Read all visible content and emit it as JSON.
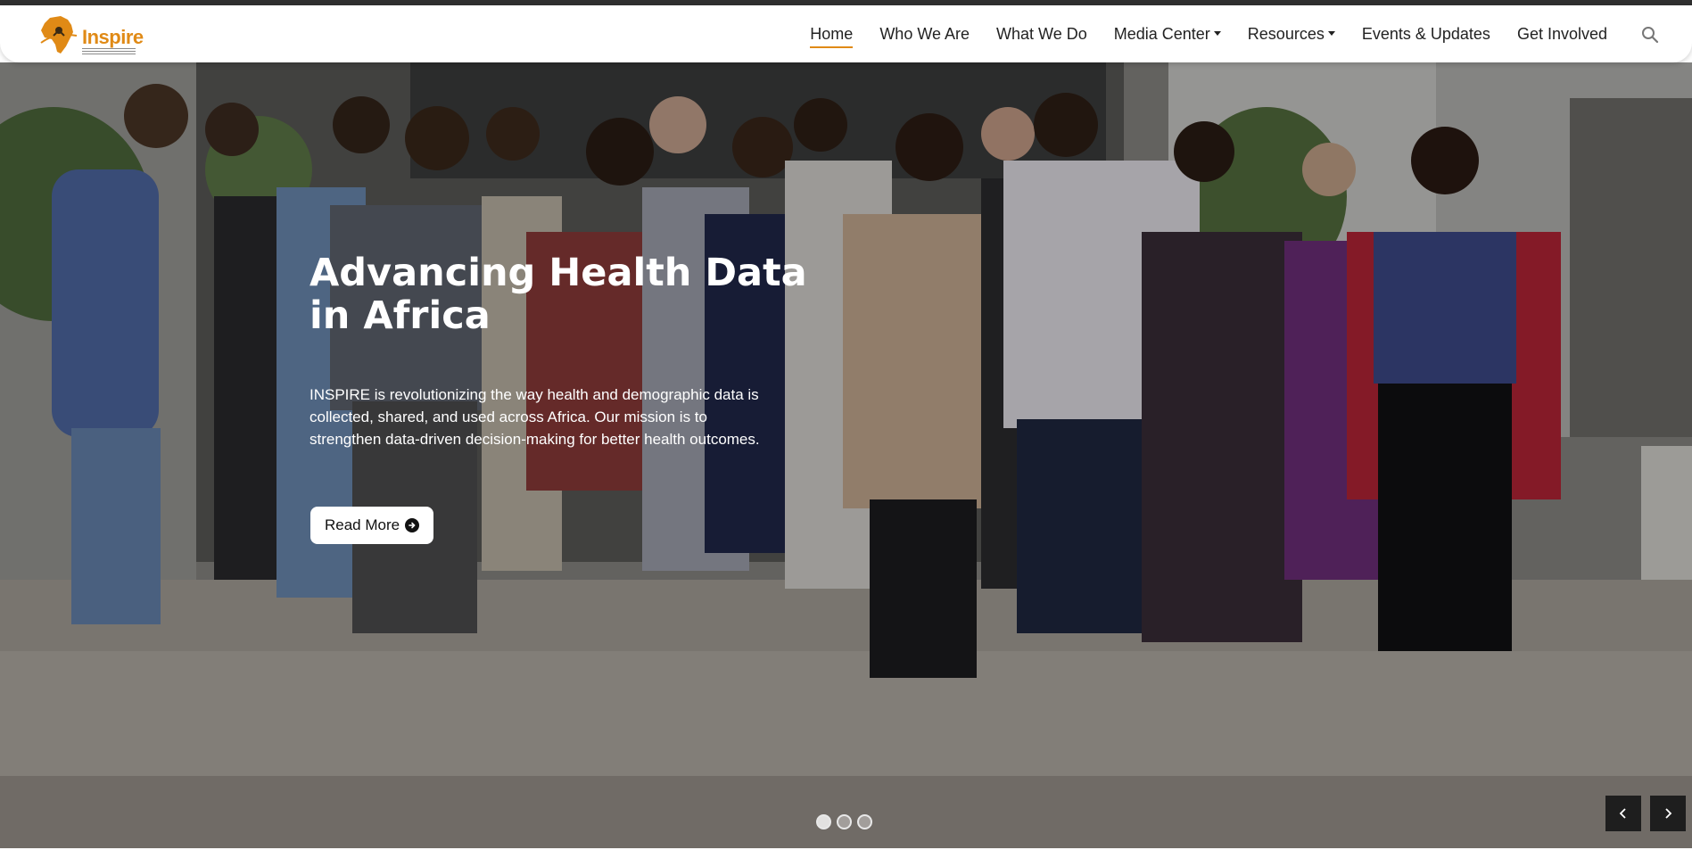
{
  "brand": {
    "logo_text": "Inspire",
    "accent_color": "#e08a16",
    "logo_icon": "africa-map-icon"
  },
  "nav": {
    "items": [
      {
        "label": "Home",
        "active": true,
        "dropdown": false
      },
      {
        "label": "Who We Are",
        "active": false,
        "dropdown": false
      },
      {
        "label": "What We Do",
        "active": false,
        "dropdown": false
      },
      {
        "label": "Media Center",
        "active": false,
        "dropdown": true
      },
      {
        "label": "Resources",
        "active": false,
        "dropdown": true
      },
      {
        "label": "Events & Updates",
        "active": false,
        "dropdown": false
      },
      {
        "label": "Get Involved",
        "active": false,
        "dropdown": false
      }
    ],
    "search_icon": "search-icon"
  },
  "hero": {
    "title": "Advancing Health Data in Africa",
    "text": "INSPIRE is revolutionizing the way health and demographic data is collected, shared, and used across Africa. Our mission is to strengthen data-driven decision-making for better health outcomes.",
    "button_label": "Read More",
    "button_icon": "arrow-right-circle-icon",
    "slides_total": 3,
    "active_slide": 1
  },
  "carousel": {
    "prev_icon": "chevron-left-icon",
    "next_icon": "chevron-right-icon"
  }
}
